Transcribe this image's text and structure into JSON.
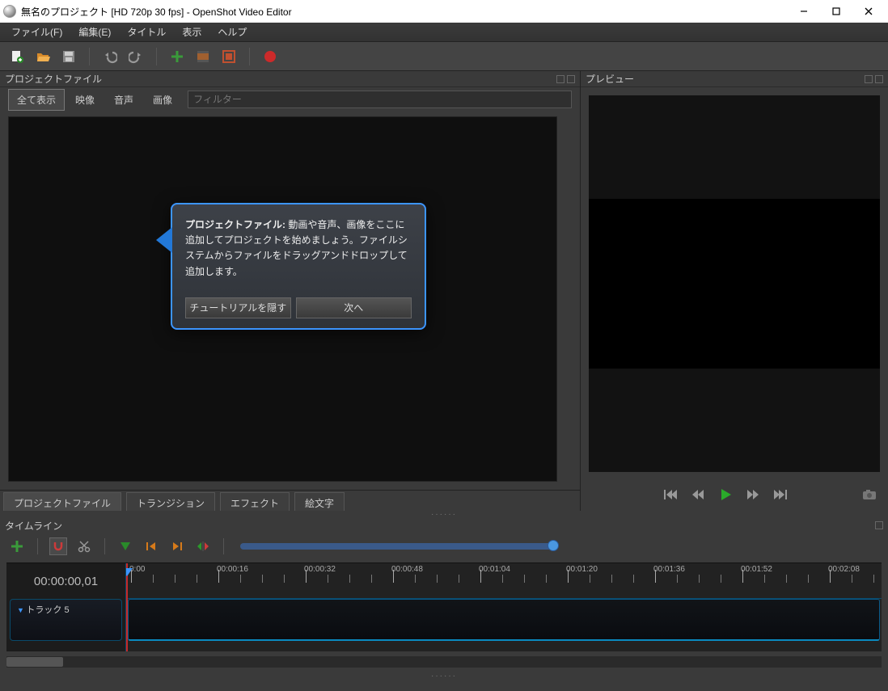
{
  "title": "無名のプロジェクト [HD 720p 30 fps] - OpenShot Video Editor",
  "menu": {
    "file": "ファイル(F)",
    "edit": "編集(E)",
    "title_m": "タイトル",
    "view": "表示",
    "help": "ヘルプ"
  },
  "panels": {
    "project": "プロジェクトファイル",
    "preview": "プレビュー",
    "timeline": "タイムライン"
  },
  "filters": {
    "all": "全て表示",
    "video": "映像",
    "audio": "音声",
    "image": "画像",
    "placeholder": "フィルター"
  },
  "tutorial": {
    "bold": "プロジェクトファイル:",
    "body": " 動画や音声、画像をここに追加してプロジェクトを始めましょう。ファイルシステムからファイルをドラッグアンドドロップして追加します。",
    "hide": "チュートリアルを隠す",
    "next": "次へ"
  },
  "left_tabs": {
    "project": "プロジェクトファイル",
    "transition": "トランジション",
    "effect": "エフェクト",
    "emoji": "絵文字"
  },
  "timeline": {
    "current": "00:00:00,01",
    "track": "トラック 5",
    "ticks": [
      "0:00",
      "00:00:16",
      "00:00:32",
      "00:00:48",
      "00:01:04",
      "00:01:20",
      "00:01:36",
      "00:01:52",
      "00:02:08"
    ]
  }
}
